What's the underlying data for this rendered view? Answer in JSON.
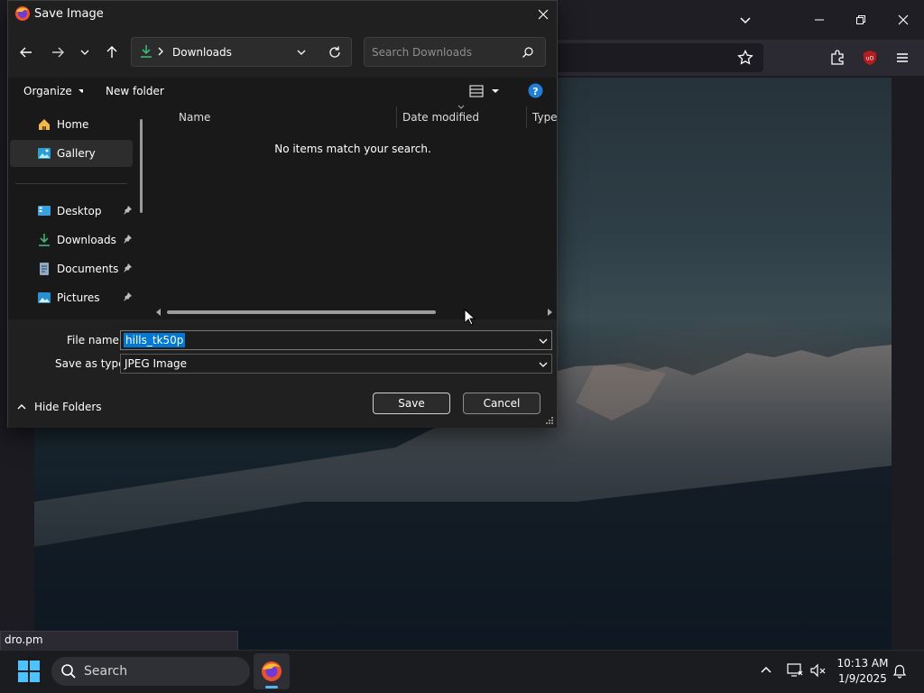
{
  "dialog": {
    "title": "Save Image",
    "breadcrumb": "Downloads",
    "search_placeholder": "Search Downloads",
    "organize_label": "Organize",
    "new_folder_label": "New folder",
    "columns": [
      "Name",
      "Date modified",
      "Type"
    ],
    "empty_message": "No items match your search.",
    "nav_items": [
      {
        "label": "Home",
        "icon": "home-icon",
        "pinned": false
      },
      {
        "label": "Gallery",
        "icon": "gallery-icon",
        "pinned": false,
        "selected": true
      },
      {
        "label": "Desktop",
        "icon": "desktop-icon",
        "pinned": true
      },
      {
        "label": "Downloads",
        "icon": "downloads-icon",
        "pinned": true
      },
      {
        "label": "Documents",
        "icon": "documents-icon",
        "pinned": true
      },
      {
        "label": "Pictures",
        "icon": "pictures-icon",
        "pinned": true
      }
    ],
    "file_name_label": "File name:",
    "file_name_value": "hills_tk50p",
    "save_type_label": "Save as type:",
    "save_type_value": "JPEG Image",
    "hide_folders_label": "Hide Folders",
    "save_label": "Save",
    "cancel_label": "Cancel"
  },
  "browser": {
    "status_link": "dro.pm"
  },
  "taskbar": {
    "search_label": "Search",
    "time": "10:13 AM",
    "date": "1/9/2025"
  },
  "colors": {
    "accent_blue": "#4cc2ff",
    "downloads_green": "#3fb57a",
    "selected_nav": "#2d2d2d"
  }
}
